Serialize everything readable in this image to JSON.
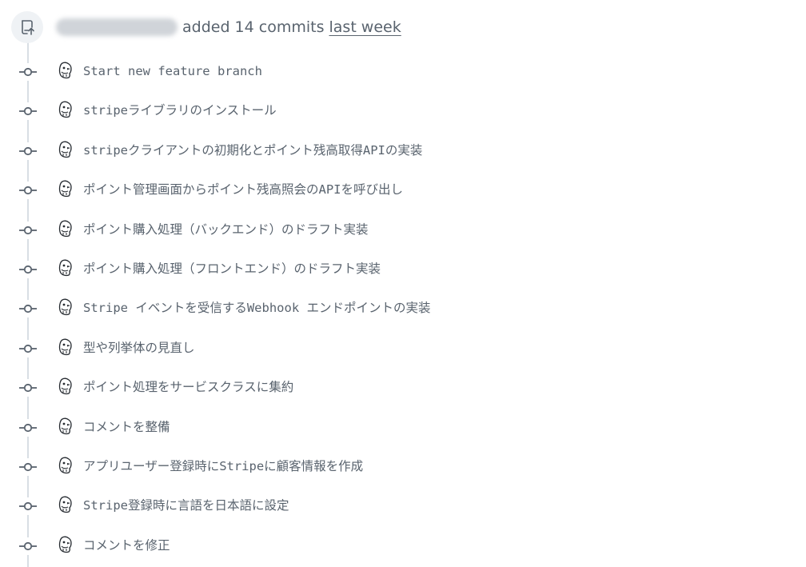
{
  "header": {
    "icon": "repo-push-icon",
    "author_hidden": true,
    "action_text": "added 14 commits",
    "when_text": "last week"
  },
  "colors": {
    "timeline": "#d8dee4",
    "text_muted": "#59636e",
    "icon_bg": "#eff2f5"
  },
  "commits": [
    {
      "icon": "git-commit-icon",
      "avatar": "bird-avatar",
      "message": "Start new feature branch"
    },
    {
      "icon": "git-commit-icon",
      "avatar": "bird-avatar",
      "message": "stripeライブラリのインストール"
    },
    {
      "icon": "git-commit-icon",
      "avatar": "bird-avatar",
      "message": "stripeクライアントの初期化とポイント残高取得APIの実装"
    },
    {
      "icon": "git-commit-icon",
      "avatar": "bird-avatar",
      "message": "ポイント管理画面からポイント残高照会のAPIを呼び出し"
    },
    {
      "icon": "git-commit-icon",
      "avatar": "bird-avatar",
      "message": "ポイント購入処理（バックエンド）のドラフト実装"
    },
    {
      "icon": "git-commit-icon",
      "avatar": "bird-avatar",
      "message": "ポイント購入処理（フロントエンド）のドラフト実装"
    },
    {
      "icon": "git-commit-icon",
      "avatar": "bird-avatar",
      "message": "Stripe イベントを受信するWebhook エンドポイントの実装"
    },
    {
      "icon": "git-commit-icon",
      "avatar": "bird-avatar",
      "message": "型や列挙体の見直し"
    },
    {
      "icon": "git-commit-icon",
      "avatar": "bird-avatar",
      "message": "ポイント処理をサービスクラスに集約"
    },
    {
      "icon": "git-commit-icon",
      "avatar": "bird-avatar",
      "message": "コメントを整備"
    },
    {
      "icon": "git-commit-icon",
      "avatar": "bird-avatar",
      "message": "アプリユーザー登録時にStripeに顧客情報を作成"
    },
    {
      "icon": "git-commit-icon",
      "avatar": "bird-avatar",
      "message": "Stripe登録時に言語を日本語に設定"
    },
    {
      "icon": "git-commit-icon",
      "avatar": "bird-avatar",
      "message": "コメントを修正"
    }
  ]
}
